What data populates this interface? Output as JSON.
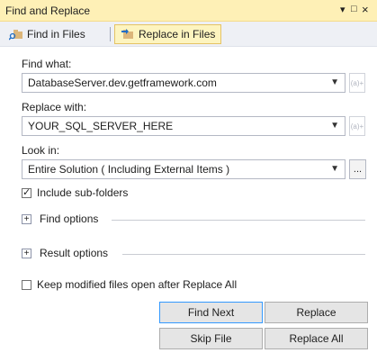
{
  "window": {
    "title": "Find and Replace",
    "pin_glyph": "▾",
    "max_glyph": "□",
    "close_glyph": "×"
  },
  "toolbar": {
    "find_in_files_label": "Find in Files",
    "replace_in_files_label": "Replace in Files"
  },
  "find_what": {
    "label": "Find what:",
    "value": "DatabaseServer.dev.getframework.com",
    "regex_glyph": "(a)+"
  },
  "replace_with": {
    "label": "Replace with:",
    "value": "YOUR_SQL_SERVER_HERE",
    "regex_glyph": "(a)+"
  },
  "look_in": {
    "label": "Look in:",
    "value": "Entire Solution ( Including External Items )",
    "browse_label": "..."
  },
  "include_subfolders": {
    "label": "Include sub-folders",
    "checked": true
  },
  "find_options": {
    "label": "Find options"
  },
  "result_options": {
    "label": "Result options"
  },
  "keep_open": {
    "label": "Keep modified files open after Replace All",
    "checked": false
  },
  "buttons": {
    "find_next": "Find Next",
    "replace": "Replace",
    "skip_file": "Skip File",
    "replace_all": "Replace All"
  },
  "colors": {
    "title_bg": "#fef0b6",
    "toolbar_bg": "#eef0f5",
    "active_tab_bg": "#fdf4bf",
    "focus_border": "#3399ff"
  }
}
